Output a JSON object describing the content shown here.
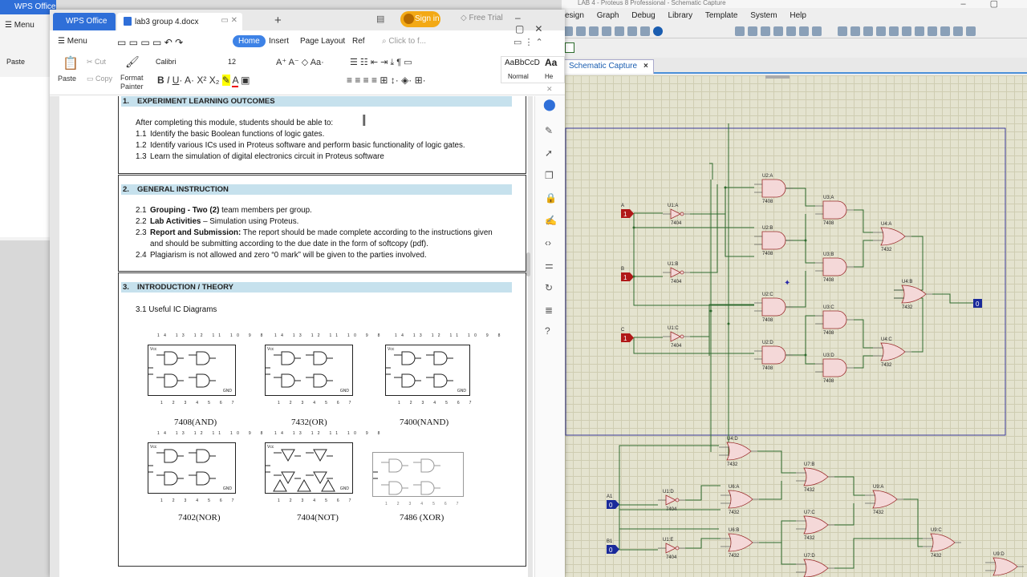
{
  "bg_wps": {
    "tab": "WPS Office",
    "menu": "Menu",
    "paste": "Paste"
  },
  "proteus": {
    "title": "LAB 4 - Proteus 8 Professional - Schematic Capture",
    "menu": [
      "esign",
      "Graph",
      "Debug",
      "Library",
      "Template",
      "System",
      "Help"
    ],
    "tab": "Schematic Capture",
    "tab_close": "×",
    "inputs": [
      {
        "label": "A",
        "value": "1"
      },
      {
        "label": "B",
        "value": "1"
      },
      {
        "label": "C",
        "value": "1"
      },
      {
        "label": "A1",
        "value": "0"
      },
      {
        "label": "B1",
        "value": "0"
      }
    ],
    "output_value": "0",
    "gates": [
      "U2:A",
      "U3:A",
      "U4:A",
      "U1:A",
      "U2:B",
      "U3:B",
      "U1:B",
      "U4:B",
      "U2:C",
      "U3:C",
      "U1:C",
      "U4:C",
      "U2:D",
      "U3:D",
      "U4:D",
      "U7:B",
      "U6:A",
      "U1:D",
      "U9:A",
      "U7:C",
      "U6:B",
      "U1:E",
      "U9:C",
      "U7:D",
      "U9:D"
    ],
    "gate_parts": [
      "7408",
      "7404",
      "7432"
    ]
  },
  "wps": {
    "tab_office": "WPS Office",
    "tab_doc": "lab3 group 4.docx",
    "new_tab": "+",
    "sign_in": "Sign in",
    "free_trial": "Free Trial",
    "menu": "Menu",
    "ribbon_tabs": {
      "home": "Home",
      "insert": "Insert",
      "page_layout": "Page Layout",
      "ref": "Ref",
      "search": "Click to f..."
    },
    "ribbon": {
      "paste": "Paste",
      "cut": "Cut",
      "copy": "Copy",
      "format_painter_1": "Format",
      "format_painter_2": "Painter",
      "font": "Calibri",
      "size": "12",
      "style_preview": "AaBbCcD",
      "style_normal": "Normal",
      "style_heading_preview": "Aa",
      "style_heading": "He"
    }
  },
  "doc": {
    "s1": {
      "num": "1.",
      "title": "EXPERIMENT LEARNING OUTCOMES",
      "intro": "After completing this module, students should be able to:",
      "items": [
        {
          "n": "1.1",
          "t": "Identify the basic Boolean functions of logic gates."
        },
        {
          "n": "1.2",
          "t": "Identify various ICs used in Proteus software and perform basic functionality of logic gates."
        },
        {
          "n": "1.3",
          "t": "Learn the simulation of digital electronics circuit in Proteus software"
        }
      ]
    },
    "s2": {
      "num": "2.",
      "title": "GENERAL INSTRUCTION",
      "i1_n": "2.1",
      "i1_b": "Grouping - Two (2)",
      "i1_t": " team members per group.",
      "i2_n": "2.2",
      "i2_b": "Lab Activities",
      "i2_t": " – Simulation using Proteus.",
      "i3_n": "2.3",
      "i3_b": "Report and Submission:",
      "i3_t": " The report should be made complete according to the instructions given",
      "i3_t2": "and should be submitting according to the due date in the form of softcopy (pdf).",
      "i4_n": "2.4",
      "i4_t": "Plagiarism is not allowed and zero “0 mark” will be given to the parties involved."
    },
    "s3": {
      "num": "3.",
      "title": "INTRODUCTION / THEORY",
      "sub": "3.1 Useful IC Diagrams",
      "ics": [
        "7408(AND)",
        "7432(OR)",
        "7400(NAND)",
        "7402(NOR)",
        "7404(NOT)",
        "7486 (XOR)"
      ],
      "top_pins": "14 13 12 11 10 9 8",
      "bottom_pins": "1 2 3 4 5 6 7",
      "vcc": "Vcc",
      "gnd": "GND"
    }
  }
}
